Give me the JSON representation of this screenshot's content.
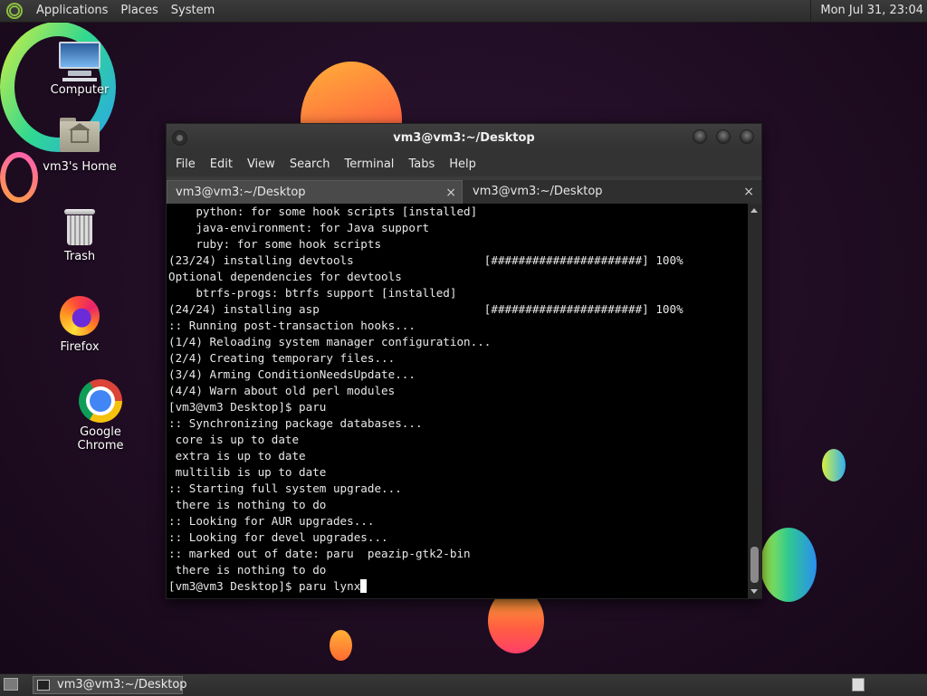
{
  "top_panel": {
    "menus": [
      "Applications",
      "Places",
      "System"
    ],
    "clock": "Mon Jul 31, 23:04"
  },
  "desktop_icons": [
    {
      "label": "Computer",
      "icon": "computer-icon"
    },
    {
      "label": "vm3's Home",
      "icon": "home-folder-icon"
    },
    {
      "label": "Trash",
      "icon": "trash-icon"
    },
    {
      "label": "Firefox",
      "icon": "firefox-icon"
    },
    {
      "label": "Google Chrome",
      "icon": "chrome-icon"
    }
  ],
  "terminal": {
    "title": "vm3@vm3:~/Desktop",
    "menu": [
      "File",
      "Edit",
      "View",
      "Search",
      "Terminal",
      "Tabs",
      "Help"
    ],
    "tabs": [
      {
        "label": "vm3@vm3:~/Desktop",
        "active": true
      },
      {
        "label": "vm3@vm3:~/Desktop",
        "active": false
      }
    ],
    "close_glyph": "×",
    "lines": [
      "    python: for some hook scripts [installed]",
      "    java-environment: for Java support",
      "    ruby: for some hook scripts",
      "(23/24) installing devtools                   [######################] 100%",
      "Optional dependencies for devtools",
      "    btrfs-progs: btrfs support [installed]",
      "(24/24) installing asp                        [######################] 100%",
      ":: Running post-transaction hooks...",
      "(1/4) Reloading system manager configuration...",
      "(2/4) Creating temporary files...",
      "(3/4) Arming ConditionNeedsUpdate...",
      "(4/4) Warn about old perl modules",
      "[vm3@vm3 Desktop]$ paru",
      ":: Synchronizing package databases...",
      " core is up to date",
      " extra is up to date",
      " multilib is up to date",
      ":: Starting full system upgrade...",
      " there is nothing to do",
      ":: Looking for AUR upgrades...",
      ":: Looking for devel upgrades...",
      ":: marked out of date: paru  peazip-gtk2-bin",
      " there is nothing to do",
      "[vm3@vm3 Desktop]$ paru lynx"
    ]
  },
  "taskbar": {
    "window_button": "vm3@vm3:~/Desktop"
  },
  "colors": {
    "terminal_bg": "#000000",
    "terminal_fg": "#e8e8e8",
    "panel_bg": "#333333",
    "wallpaper_bg": "#1d0b20"
  }
}
